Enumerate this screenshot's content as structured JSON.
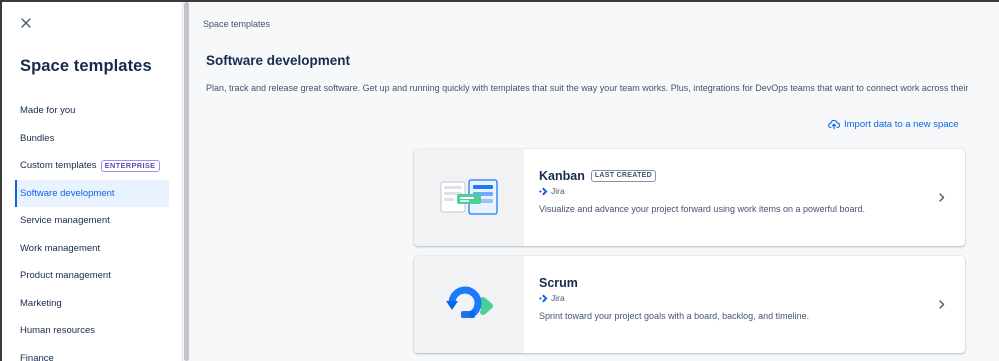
{
  "sidebar": {
    "title": "Space templates",
    "items": [
      {
        "label": "Made for you"
      },
      {
        "label": "Bundles"
      },
      {
        "label": "Custom templates",
        "badge": "ENTERPRISE"
      },
      {
        "label": "Software development",
        "selected": true
      },
      {
        "label": "Service management"
      },
      {
        "label": "Work management"
      },
      {
        "label": "Product management"
      },
      {
        "label": "Marketing"
      },
      {
        "label": "Human resources"
      },
      {
        "label": "Finance"
      }
    ]
  },
  "main": {
    "breadcrumb": "Space templates",
    "title": "Software development",
    "description": "Plan, track and release great software. Get up and running quickly with templates that suit the way your team works. Plus, integrations for DevOps teams that want to connect work across their",
    "import_link": "Import data to a new space",
    "cards": [
      {
        "title": "Kanban",
        "badge": "LAST CREATED",
        "product": "Jira",
        "description": "Visualize and advance your project forward using work items on a powerful board."
      },
      {
        "title": "Scrum",
        "product": "Jira",
        "description": "Sprint toward your project goals with a board, backlog, and timeline."
      }
    ]
  },
  "colors": {
    "accent": "#0c66e4",
    "selected_bg": "#e9f2ff",
    "text": "#172b4d",
    "subtle_text": "#44546f",
    "enterprise_purple": "#5e4db2",
    "scrum_green": "#4bce97"
  },
  "icons": {
    "close": "close-icon",
    "import": "cloud-upload-icon",
    "jira": "jira-logo-icon",
    "chevron": "chevron-right-icon"
  }
}
